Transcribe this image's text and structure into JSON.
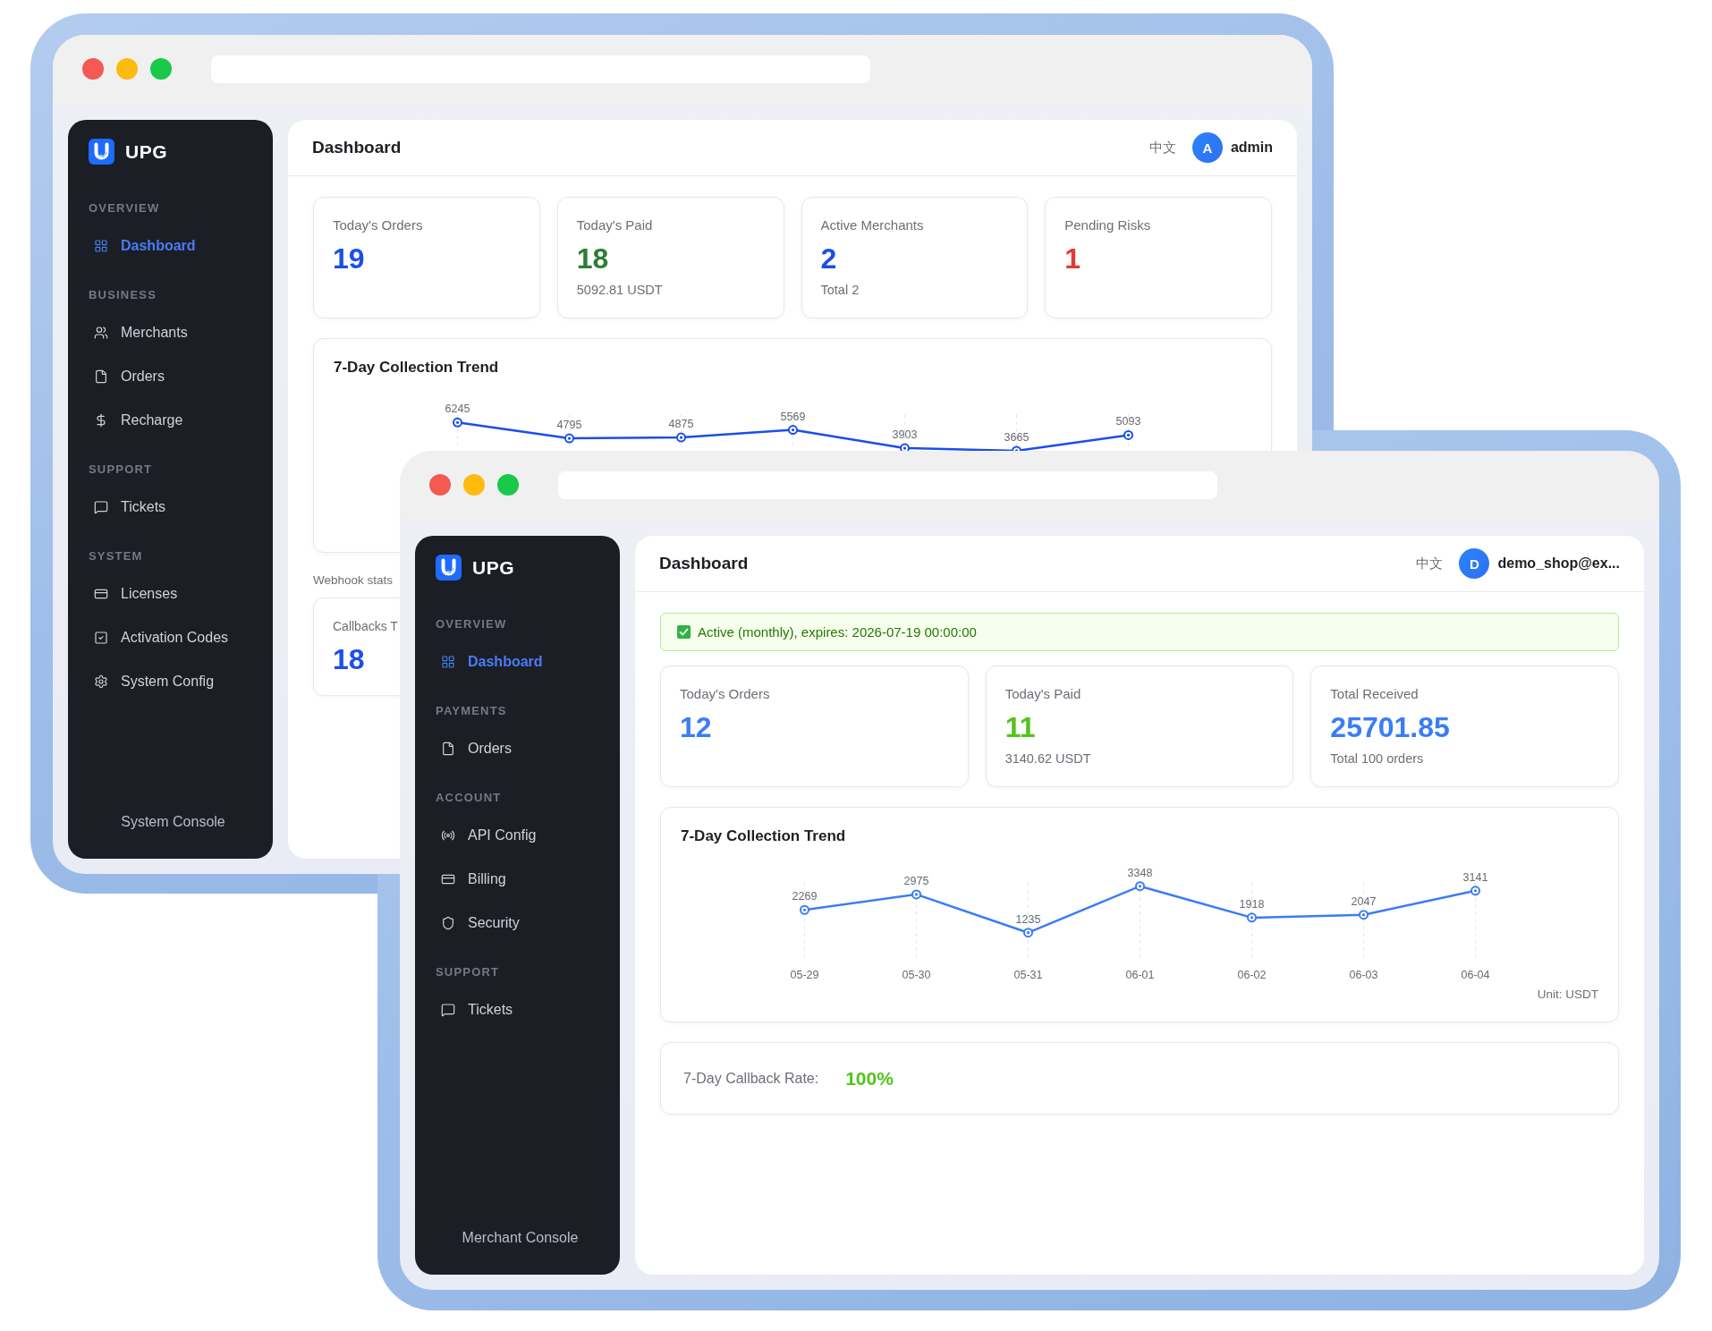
{
  "windows": [
    {
      "sidebar": {
        "brand": "UPG",
        "sections": [
          {
            "title": "OVERVIEW",
            "items": [
              {
                "label": "Dashboard",
                "selected": true
              }
            ]
          },
          {
            "title": "BUSINESS",
            "items": [
              {
                "label": "Merchants",
                "selected": false
              },
              {
                "label": "Orders",
                "selected": false
              },
              {
                "label": "Recharge",
                "selected": false
              }
            ]
          },
          {
            "title": "SUPPORT",
            "items": [
              {
                "label": "Tickets",
                "selected": false
              }
            ]
          },
          {
            "title": "SYSTEM",
            "items": [
              {
                "label": "Licenses",
                "selected": false
              },
              {
                "label": "Activation Codes",
                "selected": false
              },
              {
                "label": "System Config",
                "selected": false
              }
            ]
          }
        ],
        "footer": "System Console"
      },
      "header": {
        "title": "Dashboard",
        "language": {
          "label": "中文",
          "selected": false
        },
        "avatar": "A",
        "user": "admin"
      },
      "stats": [
        {
          "label": "Today's Orders",
          "value": "19",
          "color": "#1c4fe6"
        },
        {
          "label": "Today's Paid",
          "value": "18",
          "note": "5092.81 USDT",
          "color": "#2e7d32"
        },
        {
          "label": "Active Merchants",
          "value": "2",
          "note": "Total 2",
          "color": "#1c4fe6"
        },
        {
          "label": "Pending Risks",
          "value": "1",
          "color": "#e53935"
        }
      ],
      "trend": {
        "chart_data": {
          "type": "line",
          "title": "7-Day Collection Trend",
          "grid": true,
          "series": [
            {
              "color": "#1c4fe6",
              "marker": "circle",
              "values": [
                6245,
                4795,
                4875,
                5569,
                3903,
                3665,
                5093
              ]
            }
          ],
          "data_labels": true
        }
      },
      "webhook": {
        "title": "Webhook stats",
        "cards": [
          {
            "label": "Callbacks T",
            "value": "18",
            "color": "#1c4fe6"
          }
        ]
      }
    },
    {
      "sidebar": {
        "brand": "UPG",
        "sections": [
          {
            "title": "OVERVIEW",
            "items": [
              {
                "label": "Dashboard",
                "selected": true
              }
            ]
          },
          {
            "title": "PAYMENTS",
            "items": [
              {
                "label": "Orders",
                "selected": false
              }
            ]
          },
          {
            "title": "ACCOUNT",
            "items": [
              {
                "label": "API Config",
                "selected": false
              },
              {
                "label": "Billing",
                "selected": false
              },
              {
                "label": "Security",
                "selected": false
              }
            ]
          },
          {
            "title": "SUPPORT",
            "items": [
              {
                "label": "Tickets",
                "selected": false
              }
            ]
          }
        ],
        "footer": "Merchant Console"
      },
      "header": {
        "title": "Dashboard",
        "language": {
          "label": "中文",
          "selected": false
        },
        "avatar": "D",
        "user": "demo_shop@ex..."
      },
      "banner": {
        "text": "Active (monthly), expires: 2026-07-19 00:00:00"
      },
      "stats": [
        {
          "label": "Today's Orders",
          "value": "12",
          "color": "#3b7cf6"
        },
        {
          "label": "Today's Paid",
          "value": "11",
          "note": "3140.62 USDT",
          "color": "#52c41a"
        },
        {
          "label": "Total Received",
          "value": "25701.85",
          "note": "Total 100 orders",
          "color": "#3b7cf6"
        }
      ],
      "trend": {
        "chart_data": {
          "type": "line",
          "title": "7-Day Collection Trend",
          "grid": true,
          "categories": [
            "05-29",
            "05-30",
            "05-31",
            "06-01",
            "06-02",
            "06-03",
            "06-04"
          ],
          "series": [
            {
              "color": "#3b7cf6",
              "marker": "circle",
              "values": [
                2269,
                2975,
                1235,
                3348,
                1918,
                2047,
                3141
              ]
            }
          ],
          "data_labels": true
        },
        "unit": "Unit: USDT"
      },
      "callback_rate": {
        "label": "7-Day Callback Rate:",
        "value": "100%"
      }
    }
  ]
}
